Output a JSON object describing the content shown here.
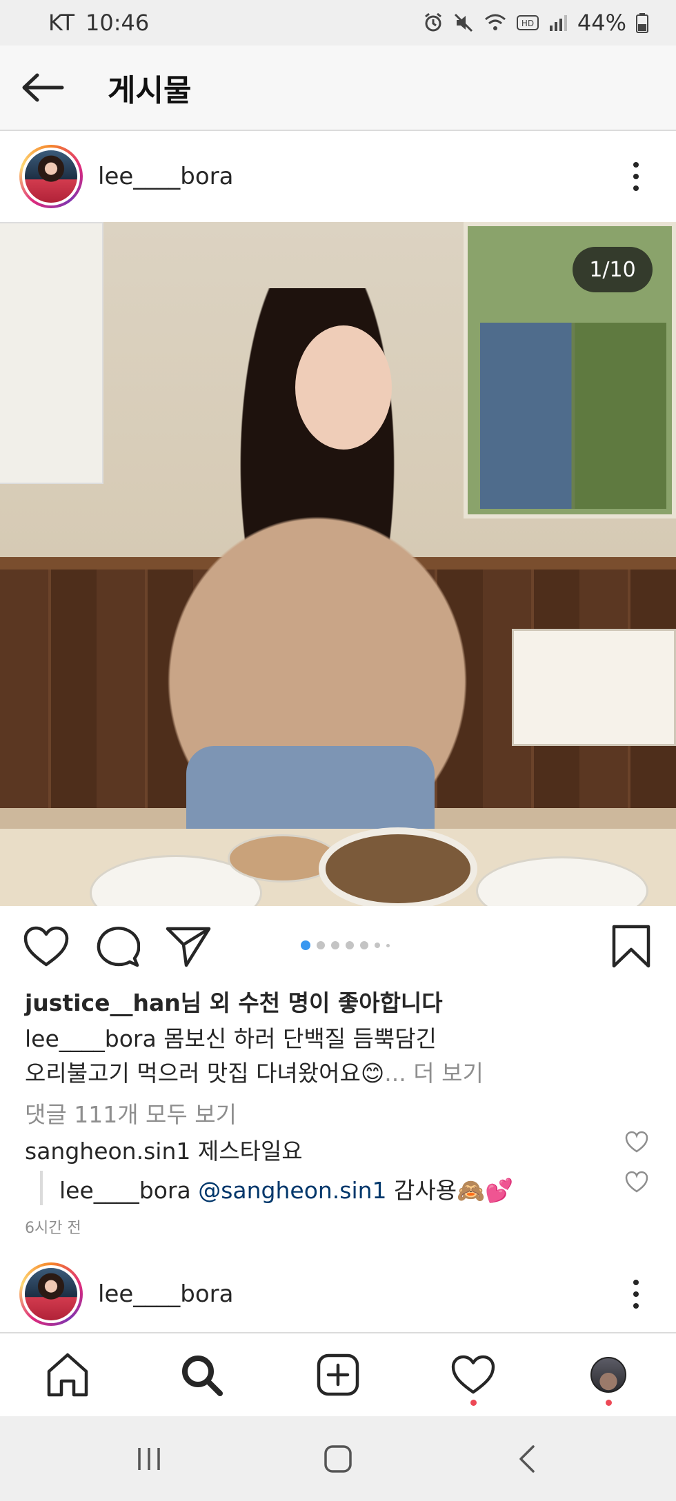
{
  "status_bar": {
    "carrier": "KT",
    "time": "10:46",
    "battery": "44%",
    "icons": [
      "alarm-icon",
      "mute-icon",
      "wifi-icon",
      "hd-voice-icon",
      "signal-icon",
      "battery-icon"
    ]
  },
  "top_bar": {
    "title": "게시물",
    "back_icon": "arrow-left-icon"
  },
  "post": {
    "username": "lee____bora",
    "image_counter": "1/10",
    "carousel": {
      "count": 7,
      "active_index": 0
    },
    "likes": {
      "user": "justice__han",
      "text": "님 외 수천 명이 좋아합니다"
    },
    "caption": {
      "user": "lee____bora",
      "line1": " 몸보신 하러 단백질 듬뿍담긴",
      "line2": "오리불고기 먹으러 맛집 다녀왔어요😊",
      "more": "... 더 보기"
    },
    "view_comments": "댓글 111개 모두 보기",
    "comments": [
      {
        "user": "sangheon.sin1",
        "text": " 제스타일요"
      }
    ],
    "reply": {
      "user": "lee____bora",
      "mention": " @sangheon.sin1",
      "text": " 감사용🙈💕"
    },
    "time_ago": "6시간 전"
  },
  "next_post": {
    "username": "lee____bora"
  },
  "bottom_nav": {
    "items": [
      "home-icon",
      "search-icon",
      "new-post-icon",
      "activity-icon",
      "profile-icon"
    ],
    "notification_color": "#ed4956"
  },
  "system_nav": {
    "items": [
      "recent-apps-icon",
      "home-button-icon",
      "back-button-icon"
    ]
  },
  "colors": {
    "text": "#262626",
    "muted": "#8e8e8e",
    "mention": "#00376b",
    "accent": "#3897f0"
  }
}
